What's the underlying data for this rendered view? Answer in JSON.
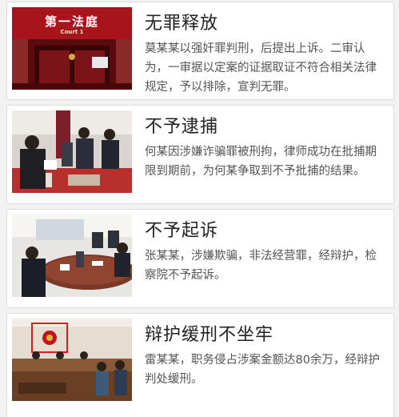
{
  "cases": [
    {
      "title": "无罪释放",
      "description": "莫某某以强奸罪判刑，后提出上诉。二审认为，一审据以定案的证据取证不符合相关法律规定，予以排除，宣判无罪。",
      "image": "courtroom-entrance-photo",
      "sign_text": "第一法庭",
      "sign_sub": "Court 1"
    },
    {
      "title": "不予逮捕",
      "description": "何某因涉嫌诈骗罪被刑拘，律师成功在批捕期限到期前，为何某争取到不予批捕的结果。",
      "image": "evidence-inspection-photo"
    },
    {
      "title": "不予起诉",
      "description": "张某某，涉嫌欺骗，非法经营罪，经辩护，检察院不予起诉。",
      "image": "meeting-room-photo"
    },
    {
      "title": "辩护缓刑不坐牢",
      "description": "雷某某，职务侵占涉案金额达80余万，经辩护判处缓刑。",
      "image": "courtroom-hearing-photo"
    }
  ],
  "colors": {
    "title": "#222222",
    "description": "#555555",
    "accent_red": "#c0161e"
  }
}
